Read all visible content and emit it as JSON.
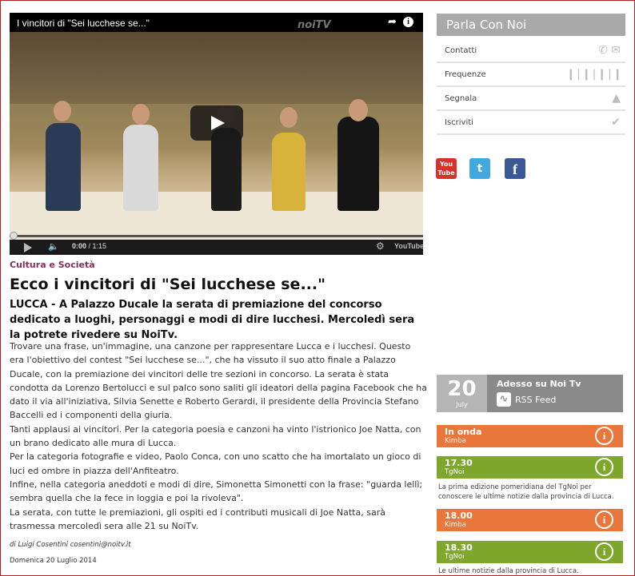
{
  "video": {
    "title": "I vincitori di \"Sei lucchese se...\"",
    "watermark": "noiTV",
    "time_current": "0:00",
    "time_total": "1:15",
    "youtube_label": "YouTube"
  },
  "article": {
    "category": "Cultura e Società",
    "headline": "Ecco i vincitori di \"Sei lucchese se...\"",
    "subheadline": "LUCCA - A Palazzo Ducale la serata di premiazione del concorso dedicato a luoghi, personaggi e modi di dire lucchesi. Mercoledì sera la potrete rivedere su NoiTv.",
    "paragraphs": [
      "Trovare una frase, un'immagine, una canzone per rappresentare Lucca e i lucchesi. Questo era l'obiettivo del contest \"Sei lucchese se...\", che ha vissuto il suo atto finale a Palazzo Ducale, con la premiazione dei vincitori delle tre sezioni in concorso. La serata è stata condotta da Lorenzo Bertolucci e sul palco sono saliti gli ideatori della pagina Facebook che ha dato il via all'iniziativa, Silvia Senette e Roberto Gerardi, il presidente della Provincia Stefano Baccelli ed i componenti della giuria.",
      "Tanti applausi ai vincitori. Per la categoria poesia e canzoni ha vinto l'istrionico Joe Natta, con un brano dedicato alle mura di Lucca.",
      "Per la categoria fotografie e video, Paolo Conca, con uno scatto che ha imortalato un gioco di luci ed ombre in piazza dell'Anfiteatro.",
      "Infine, nella categoria aneddoti e modi di dire, Simonetta Simonetti con la frase: \"guarda lellì; sembra quella che la fece in loggia e poi la rivoleva\".",
      "La serata, con tutte le premiazioni, gli ospiti ed i contributi musicali di Joe Natta, sarà trasmessa mercoledì sera alle 21 su NoiTv."
    ],
    "byline": "di Luigi Cosentini cosentini@noitv.it",
    "date": "Domenica 20 Luglio 2014"
  },
  "sidebar": {
    "contact_title": "Parla Con Noi",
    "contact_items": [
      {
        "label": "Contatti",
        "icon": "phone-mail-icon"
      },
      {
        "label": "Frequenze",
        "icon": "waveform-icon"
      },
      {
        "label": "Segnala",
        "icon": "signal-icon"
      },
      {
        "label": "Iscriviti",
        "icon": "check-icon"
      }
    ],
    "social": {
      "youtube": "You Tube",
      "twitter": "t",
      "facebook": "f"
    },
    "now": {
      "day": "20",
      "month": "July",
      "title": "Adesso su Noi Tv",
      "rss": "RSS Feed"
    },
    "schedule": [
      {
        "time": "In onda",
        "program": "Kimba",
        "color": "#e9763a"
      },
      {
        "time": "17.30",
        "program": "TgNoi",
        "color": "#7ea72b",
        "desc": "La prima edizione pomeridiana del TgNoi per conoscere le ultime notizie dalla provincia di Lucca."
      },
      {
        "time": "18.00",
        "program": "Kimba",
        "color": "#e9763a"
      },
      {
        "time": "18.30",
        "program": "TgNoi",
        "color": "#7ea72b",
        "desc": "Le ultime notizie dalla provincia di Lucca."
      }
    ]
  }
}
